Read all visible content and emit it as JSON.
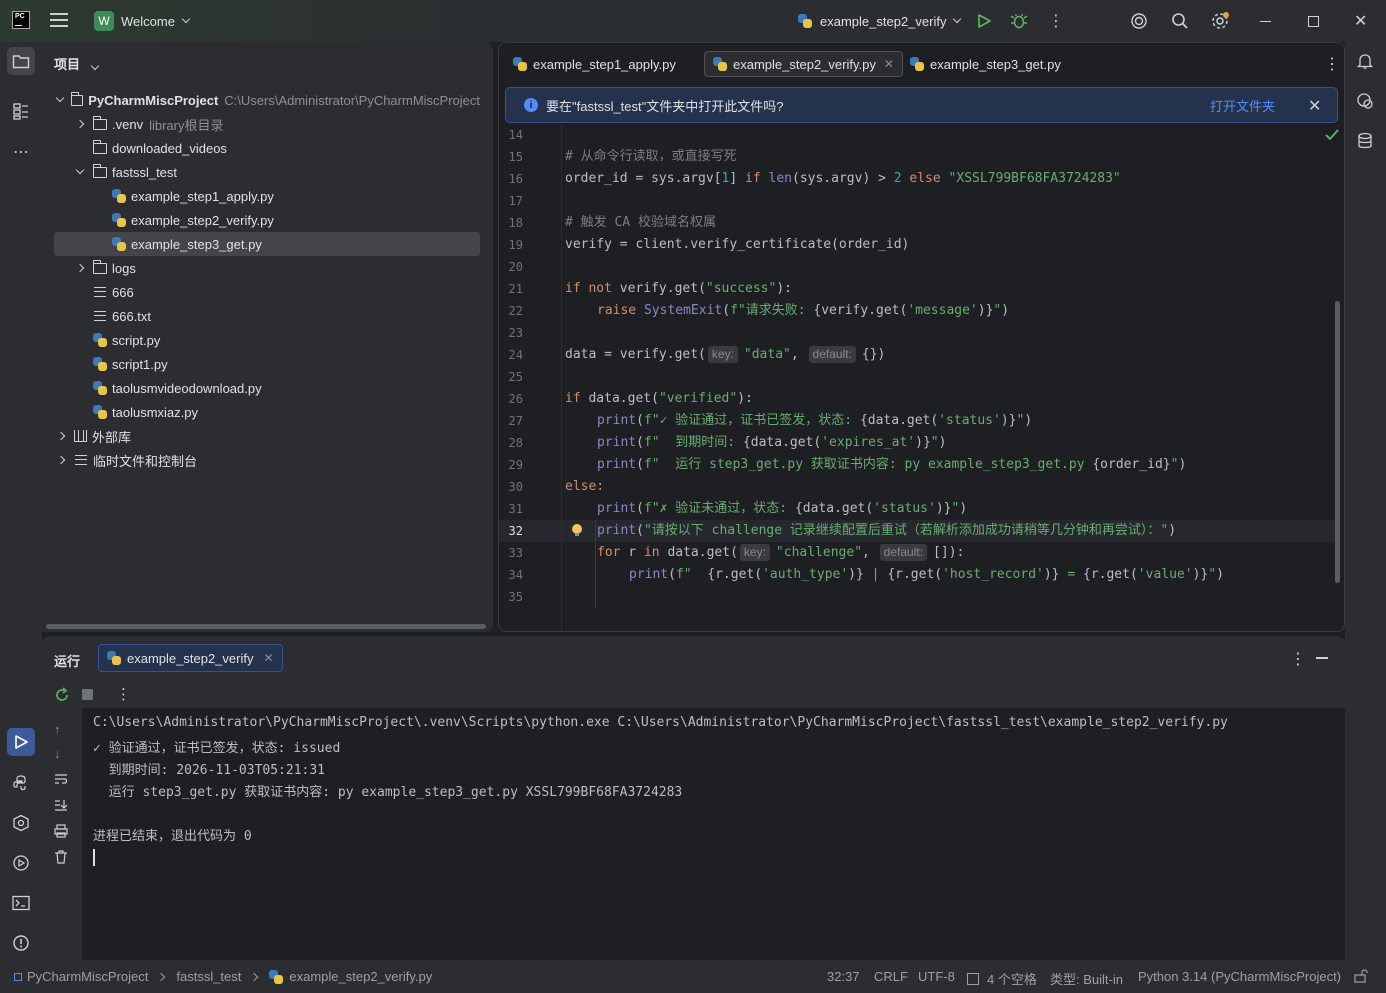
{
  "titlebar": {
    "project_badge": "W",
    "project_name": "Welcome",
    "run_config": "example_step2_verify"
  },
  "project_panel": {
    "title": "项目",
    "tree": [
      {
        "label": "PyCharmMiscProject",
        "hint": "C:\\Users\\Administrator\\PyCharmMiscProject"
      },
      {
        "label": ".venv",
        "hint": "library根目录"
      },
      {
        "label": "downloaded_videos"
      },
      {
        "label": "fastssl_test"
      },
      {
        "label": "example_step1_apply.py"
      },
      {
        "label": "example_step2_verify.py"
      },
      {
        "label": "example_step3_get.py"
      },
      {
        "label": "logs"
      },
      {
        "label": "666"
      },
      {
        "label": "666.txt"
      },
      {
        "label": "script.py"
      },
      {
        "label": "script1.py"
      },
      {
        "label": "taolusmvideodownload.py"
      },
      {
        "label": "taolusmxiaz.py"
      },
      {
        "label": "外部库"
      },
      {
        "label": "临时文件和控制台"
      }
    ]
  },
  "editor": {
    "tabs": [
      "example_step1_apply.py",
      "example_step2_verify.py",
      "example_step3_get.py"
    ],
    "active_tab": "example_step2_verify.py",
    "banner": {
      "text": "要在\"fastssl_test\"文件夹中打开此文件吗?",
      "action": "打开文件夹"
    },
    "line_numbers": [
      "14",
      "15",
      "16",
      "17",
      "18",
      "19",
      "20",
      "21",
      "22",
      "23",
      "24",
      "25",
      "26",
      "27",
      "28",
      "29",
      "30",
      "31",
      "32",
      "33",
      "34",
      "35"
    ],
    "current_line": "32",
    "hints": {
      "key": "key:",
      "default": "default:"
    },
    "code": {
      "l15": "# 从命令行读取，或直接写死",
      "l16_a": "order_id = sys.argv[",
      "l16_b": "1",
      "l16_c": "] ",
      "l16_d": "if ",
      "l16_e": "len",
      "l16_f": "(sys.argv) > ",
      "l16_g": "2",
      "l16_h": " else ",
      "l16_i": "\"XSSL799BF68FA3724283\"",
      "l18": "# 触发 CA 校验域名权属",
      "l19": "verify = client.verify_certificate(order_id)",
      "l21_a": "if not ",
      "l21_b": "verify.get(",
      "l21_c": "\"success\"",
      "l21_d": "):",
      "l22_a": "raise ",
      "l22_b": "SystemExit",
      "l22_c": "(",
      "l22_d": "f\"请求失败: ",
      "l22_e": "{verify.get(",
      "l22_f": "'message'",
      "l22_g": ")}",
      "l22_h": "\"",
      "l22_i": ")",
      "l24_a": "data = verify.get(",
      "l24_b": "\"data\"",
      "l24_c": ", ",
      "l24_d": "{})",
      "l26_a": "if ",
      "l26_b": "data.get(",
      "l26_c": "\"verified\"",
      "l26_d": "):",
      "l27_a": "print",
      "l27_b": "(",
      "l27_c": "f\"✓ 验证通过，证书已签发，状态: ",
      "l27_d": "{data.get(",
      "l27_e": "'status'",
      "l27_f": ")}",
      "l27_g": "\"",
      "l27_h": ")",
      "l28_a": "print",
      "l28_b": "(",
      "l28_c": "f\"  到期时间: ",
      "l28_d": "{data.get(",
      "l28_e": "'expires_at'",
      "l28_f": ")}",
      "l28_g": "\"",
      "l28_h": ")",
      "l29_a": "print",
      "l29_b": "(",
      "l29_c": "f\"  运行 step3_get.py 获取证书内容: py example_step3_get.py ",
      "l29_d": "{order_id}",
      "l29_e": "\"",
      "l29_f": ")",
      "l30": "else:",
      "l31_a": "print",
      "l31_b": "(",
      "l31_c": "f\"✗ 验证未通过，状态: ",
      "l31_d": "{data.get(",
      "l31_e": "'status'",
      "l31_f": ")}",
      "l31_g": "\"",
      "l31_h": ")",
      "l32_a": "print",
      "l32_b": "(",
      "l32_c": "\"请按以下 challenge 记录继续配置后重试（若解析添加成功请稍等几分钟和再尝试）：\"",
      "l32_d": ")",
      "l33_a": "for ",
      "l33_b": "r ",
      "l33_c": "in ",
      "l33_d": "data.get(",
      "l33_e": "\"challenge\"",
      "l33_f": ", ",
      "l33_g": "[]):",
      "l34_a": "print",
      "l34_b": "(",
      "l34_c": "f\"  ",
      "l34_d": "{r.get(",
      "l34_e": "'auth_type'",
      "l34_f": ")}",
      "l34_g": " | ",
      "l34_h": "{r.get(",
      "l34_i": "'host_record'",
      "l34_j": ")}",
      "l34_k": " = ",
      "l34_l": "{r.get(",
      "l34_m": "'value'",
      "l34_n": ")}",
      "l34_o": "\"",
      "l34_p": ")"
    }
  },
  "run_panel": {
    "title": "运行",
    "tab": "example_step2_verify",
    "console": [
      "C:\\Users\\Administrator\\PyCharmMiscProject\\.venv\\Scripts\\python.exe C:\\Users\\Administrator\\PyCharmMiscProject\\fastssl_test\\example_step2_verify.py",
      "✓ 验证通过，证书已签发，状态: issued",
      "  到期时间: 2026-11-03T05:21:31",
      "  运行 step3_get.py 获取证书内容: py example_step3_get.py XSSL799BF68FA3724283",
      "",
      "进程已结束，退出代码为 0"
    ]
  },
  "statusbar": {
    "breadcrumb": [
      "PyCharmMiscProject",
      "fastssl_test",
      "example_step2_verify.py"
    ],
    "position": "32:37",
    "line_sep": "CRLF",
    "encoding": "UTF-8",
    "indent": "4 个空格",
    "file_type": "类型: Built-in",
    "interpreter": "Python 3.14 (PyCharmMiscProject)"
  },
  "colors": {
    "accent": "#3d5b99",
    "banner_bg": "#25324d",
    "string": "#6aab73",
    "keyword": "#cf8e6d",
    "function": "#56a8f5",
    "number": "#2aacb8",
    "comment": "#7a7e85"
  }
}
